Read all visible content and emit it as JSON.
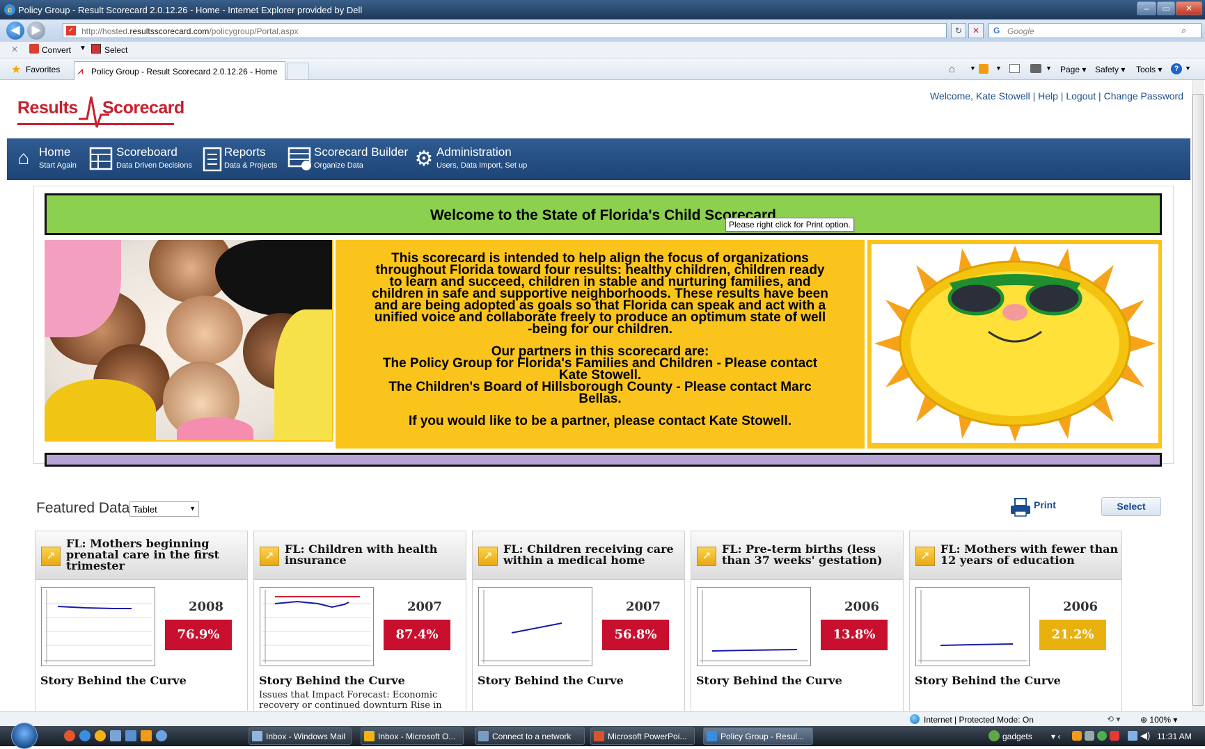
{
  "window": {
    "title": "Policy Group - Result Scorecard 2.0.12.26 - Home - Internet Explorer provided by Dell",
    "minimize": "–",
    "maximize": "▭",
    "close": "✕"
  },
  "browser": {
    "url_prefix": "http://hosted.",
    "url_host": "resultsscorecard.com",
    "url_path": "/policygroup/Portal.aspx",
    "search_placeholder": "Google",
    "convert_label": "Convert",
    "select_label": "Select",
    "favorites_label": "Favorites",
    "tab_title": "Policy Group - Result Scorecard 2.0.12.26 - Home",
    "menu": {
      "page": "Page",
      "safety": "Safety",
      "tools": "Tools"
    }
  },
  "site": {
    "logo_left": "Results",
    "logo_right": "Scorecard",
    "welcome_prefix": "Welcome, ",
    "user_name": "Kate Stowell",
    "sep": " | ",
    "help": "Help",
    "logout": "Logout",
    "change_password": "Change Password",
    "nav": [
      {
        "label": "Home",
        "sub": "Start Again"
      },
      {
        "label": "Scoreboard",
        "sub": "Data Driven Decisions"
      },
      {
        "label": "Reports",
        "sub": "Data & Projects"
      },
      {
        "label": "Scorecard Builder",
        "sub": "Organize Data"
      },
      {
        "label": "Administration",
        "sub": "Users, Data Import, Set up"
      }
    ],
    "banner_title": "Welcome to the State of Florida's Child Scorecard",
    "tooltip": "Please right click for Print option.",
    "intro_lines": [
      "This scorecard is intended to help align the focus of organizations",
      "throughout Florida toward four results: healthy children, children ready",
      "to learn and succeed, children in stable and nurturing families, and",
      "children in safe and supportive neighborhoods. These results have been",
      "and are being adopted as goals so that Florida can speak and act with a",
      "unified voice and collaborate freely to produce an optimum state of well",
      "-being for our children."
    ],
    "partners_lines": [
      "Our partners in this scorecard are:",
      "The Policy Group for Florida's Families and Children - Please contact",
      "Kate Stowell.",
      "The Children's Board of Hillsborough County - Please contact Marc",
      "Bellas."
    ],
    "partner_cta": "If you would like to be a partner, please contact Kate Stowell.",
    "featured_label": "Featured Data",
    "featured_view": "Tablet",
    "print_label": "Print",
    "select_button": "Select",
    "cards": [
      {
        "title": "FL: Mothers beginning prenatal care in the first trimester",
        "year": "2008",
        "value": "76.9%",
        "color": "#c8102e",
        "story": "Story Behind the Curve",
        "extra": ""
      },
      {
        "title": "FL: Children with health insurance",
        "year": "2007",
        "value": "87.4%",
        "color": "#c8102e",
        "story": "Story Behind the Curve",
        "extra": "Issues that Impact Forecast: Economic recovery or continued downturn Rise in"
      },
      {
        "title": "FL: Children receiving care within a medical home",
        "year": "2007",
        "value": "56.8%",
        "color": "#c8102e",
        "story": "Story Behind the Curve",
        "extra": ""
      },
      {
        "title": "FL: Pre-term births (less than 37 weeks' gestation)",
        "year": "2006",
        "value": "13.8%",
        "color": "#c8102e",
        "story": "Story Behind the Curve",
        "extra": ""
      },
      {
        "title": "FL: Mothers with fewer than 12 years of education",
        "year": "2006",
        "value": "21.2%",
        "color": "#e8b10e",
        "story": "Story Behind the Curve",
        "extra": ""
      }
    ]
  },
  "status": {
    "zone": "Internet | Protected Mode: On",
    "zoom": "100%"
  },
  "taskbar": {
    "items": [
      {
        "label": "Inbox - Windows Mail"
      },
      {
        "label": "Inbox - Microsoft O..."
      },
      {
        "label": "Connect to a network"
      },
      {
        "label": "Microsoft PowerPoi..."
      },
      {
        "label": "Policy Group - Resul..."
      }
    ],
    "gadgets": "gadgets",
    "clock": "11:31 AM"
  }
}
